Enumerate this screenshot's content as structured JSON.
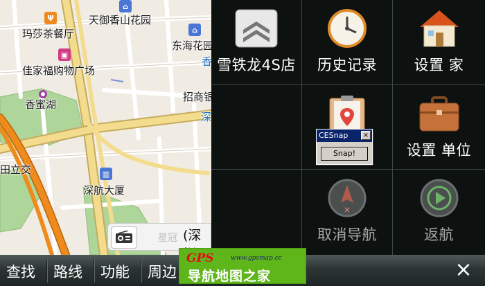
{
  "map": {
    "pois": [
      {
        "id": "tianyu",
        "label": "天御香山花园"
      },
      {
        "id": "masha",
        "label": "玛莎茶餐厅"
      },
      {
        "id": "donghai",
        "label": "东海花园"
      },
      {
        "id": "jiajiafu",
        "label": "佳家福购物广场"
      },
      {
        "id": "xiangmi",
        "label": "香蜜湖"
      },
      {
        "id": "zhaoshang",
        "label": "招商银"
      },
      {
        "id": "tianli",
        "label": "田立交"
      },
      {
        "id": "shenhang",
        "label": "深航大厦"
      }
    ],
    "road_labels": {
      "xiang": "香",
      "shen": "深"
    },
    "card_text": "星冠",
    "city_text": "(深圳"
  },
  "menu": {
    "citroen": "雪铁龙4S店",
    "history": "历史记录",
    "set_home": "设置 家",
    "set_work": "设置 单位",
    "cancel_nav": "取消导航",
    "return_nav": "返航"
  },
  "cesnap": {
    "title": "CESnap",
    "close": "×",
    "button": "Snap!"
  },
  "bottom_bar": {
    "search": "查找",
    "route": "路线",
    "function": "功能",
    "nearby": "周边",
    "close": "×"
  },
  "watermark": {
    "logo": "GPS",
    "url": "www.gpsmap.cc",
    "text": "导航地图之家"
  },
  "colors": {
    "grid_bg": "#0d1211",
    "map_bg": "#f1ece3",
    "road_yellow": "#f3dc8d",
    "road_orange": "#ef8a1c",
    "park_green": "#aed59a",
    "watermark_green": "#5fb61a"
  }
}
